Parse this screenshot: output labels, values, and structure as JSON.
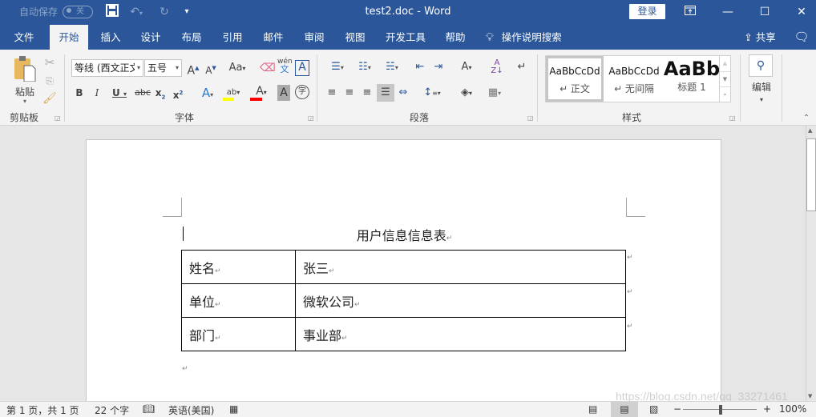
{
  "titlebar": {
    "autosave_label": "自动保存",
    "autosave_state": "关",
    "document_title": "test2.doc  -  Word",
    "login_label": "登录",
    "icons": [
      "save-icon",
      "undo-icon",
      "redo-icon",
      "customize-qat-icon",
      "ribbon-display-icon",
      "minimize-icon",
      "maximize-icon",
      "close-icon"
    ]
  },
  "menu": {
    "tabs": [
      {
        "label": "文件"
      },
      {
        "label": "开始",
        "active": true
      },
      {
        "label": "插入"
      },
      {
        "label": "设计"
      },
      {
        "label": "布局"
      },
      {
        "label": "引用"
      },
      {
        "label": "邮件"
      },
      {
        "label": "审阅"
      },
      {
        "label": "视图"
      },
      {
        "label": "开发工具"
      },
      {
        "label": "帮助"
      }
    ],
    "tell_me": "操作说明搜索",
    "share_label": "共享"
  },
  "ribbon": {
    "clipboard": {
      "label": "剪贴板",
      "paste_label": "粘贴"
    },
    "font": {
      "label": "字体",
      "font_name": "等线 (西文正文)",
      "font_size": "五号",
      "change_case": "Aa",
      "phonetic_top": "wén",
      "phonetic_bottom": "文",
      "enclose_char": "字",
      "underline_color": "#ffff00",
      "font_color": "#ff0000"
    },
    "paragraph": {
      "label": "段落"
    },
    "styles": {
      "label": "样式",
      "items": [
        {
          "preview": "AaBbCcDd",
          "name": "↵ 正文",
          "selected": true
        },
        {
          "preview": "AaBbCcDd",
          "name": "↵ 无间隔"
        },
        {
          "preview": "AaBb",
          "name": "标题 1"
        }
      ]
    },
    "editing": {
      "label": "编辑"
    }
  },
  "document": {
    "title": "用户信息信息表",
    "table": [
      {
        "label": "姓名",
        "value": "张三"
      },
      {
        "label": "单位",
        "value": "微软公司"
      },
      {
        "label": "部门",
        "value": "事业部"
      }
    ],
    "para_mark": "↵"
  },
  "statusbar": {
    "page": "第 1 页，共 1 页",
    "words": "22 个字",
    "language": "英语(美国)",
    "zoom": "100%",
    "zoom_level_percent": 100
  },
  "watermark": "https://blog.csdn.net/qq_33271461",
  "colors": {
    "accent": "#2b579a",
    "ribbon_bg": "#f3f3f3",
    "canvas": "#e6e6e6"
  }
}
